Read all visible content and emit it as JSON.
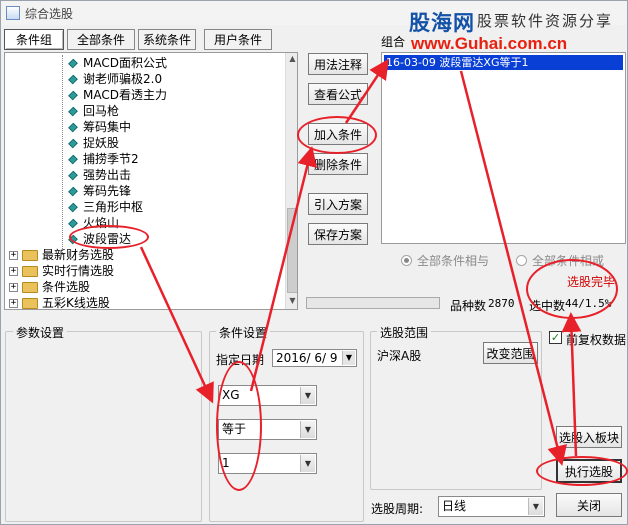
{
  "window": {
    "title": "综合选股"
  },
  "watermark": {
    "site": "股海网",
    "tagline": "股票软件资源分享",
    "url": "www.Guhai.com.cn"
  },
  "tabs": [
    "条件组",
    "全部条件",
    "系统条件",
    "用户条件"
  ],
  "tree": {
    "items": [
      "MACD面积公式",
      "谢老师骗极2.0",
      "MACD看透主力",
      "回马枪",
      "筹码集中",
      "捉妖股",
      "捕捞季节2",
      "强势出击",
      "筹码先锋",
      "三角形中枢",
      "火焰山",
      "波段雷达"
    ],
    "folders": [
      "最新财务选股",
      "实时行情选股",
      "条件选股",
      "五彩K线选股"
    ]
  },
  "middle_buttons": {
    "usage_note": "用法注释",
    "view_formula": "查看公式",
    "add_condition": "加入条件",
    "delete_condition": "删除条件",
    "import_plan": "引入方案",
    "save_plan": "保存方案"
  },
  "combo_panel": {
    "label": "组合",
    "selected_item": "16-03-09 波段雷达XG等于1"
  },
  "radios": {
    "and": "全部条件相与",
    "or": "全部条件相或"
  },
  "status": {
    "done": "选股完毕",
    "count_label": "品种数",
    "count_value": "2870",
    "selected_label": "选中数",
    "selected_value": "44/1.5%"
  },
  "params": {
    "title": "参数设置"
  },
  "condition_settings": {
    "title": "条件设置",
    "date_label": "指定日期",
    "date_value": "2016/ 6/ 9",
    "var": "XG",
    "op": "等于",
    "value": "1"
  },
  "range": {
    "title": "选股范围",
    "value": "沪深A股",
    "change_button": "改变范围"
  },
  "restore_rights": {
    "label": "前复权数据",
    "checked": true
  },
  "actions": {
    "to_block": "选股入板块",
    "execute": "执行选股",
    "close": "关闭"
  },
  "period": {
    "label": "选股周期:",
    "value": "日线"
  },
  "colors": {
    "annotation": "#e8202a",
    "selection": "#0a3fd6",
    "done_text": "#d40000"
  }
}
